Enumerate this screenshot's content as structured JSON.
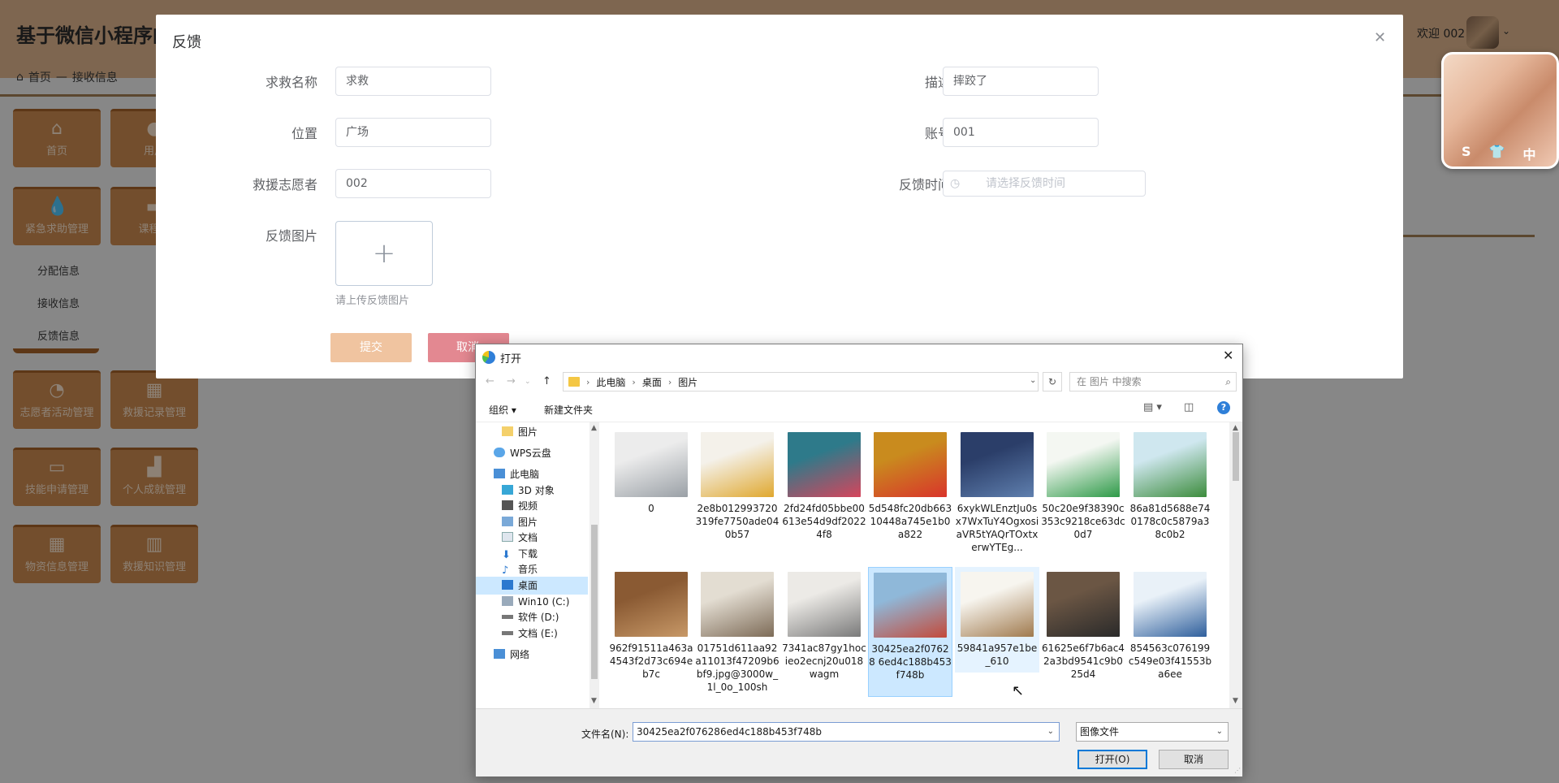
{
  "header": {
    "app_title": "基于微信小程序的",
    "welcome": "欢迎 002"
  },
  "breadcrumb": {
    "home": "首页",
    "separator": "—",
    "current": "接收信息"
  },
  "sidebar": {
    "tiles": [
      {
        "label": "首页",
        "icon": "home-icon"
      },
      {
        "label": "用户",
        "icon": "user-icon"
      },
      {
        "label": "紧急求助管理",
        "icon": "drop-icon"
      },
      {
        "label": "课程信",
        "icon": "doc-icon"
      },
      {
        "label": "志愿者活动管理",
        "icon": "pie-icon"
      },
      {
        "label": "救援记录管理",
        "icon": "grid-icon"
      },
      {
        "label": "技能申请管理",
        "icon": "briefcase-icon"
      },
      {
        "label": "个人成就管理",
        "icon": "chart-icon"
      },
      {
        "label": "物资信息管理",
        "icon": "grid-icon"
      },
      {
        "label": "救援知识管理",
        "icon": "book-icon"
      }
    ],
    "submenu": [
      "分配信息",
      "接收信息",
      "反馈信息"
    ]
  },
  "floating_photo": {
    "chips": [
      "S",
      "👕",
      "中"
    ]
  },
  "feedback_dialog": {
    "title": "反馈",
    "fields": {
      "rescue_name": {
        "label": "求救名称",
        "value": "求救"
      },
      "description": {
        "label": "描述",
        "value": "摔跤了"
      },
      "location": {
        "label": "位置",
        "value": "广场"
      },
      "account": {
        "label": "账号",
        "value": "001"
      },
      "volunteer": {
        "label": "救援志愿者",
        "value": "002"
      },
      "feedback_time": {
        "label": "反馈时间",
        "placeholder": "请选择反馈时间"
      },
      "feedback_image": {
        "label": "反馈图片",
        "tip": "请上传反馈图片"
      }
    },
    "submit": "提交",
    "cancel": "取消"
  },
  "file_dialog": {
    "title": "打开",
    "path": [
      "此电脑",
      "桌面",
      "图片"
    ],
    "search_placeholder": "在 图片 中搜索",
    "toolbar": {
      "organize": "组织 ▾",
      "new_folder": "新建文件夹"
    },
    "nav_pane": [
      {
        "label": "图片",
        "icon": "folder-icon",
        "indent": 2
      },
      {
        "label": "WPS云盘",
        "icon": "cloud-icon",
        "indent": 1
      },
      {
        "label": "此电脑",
        "icon": "pc-icon",
        "indent": 1
      },
      {
        "label": "3D 对象",
        "icon": "cube-icon",
        "indent": 2
      },
      {
        "label": "视频",
        "icon": "video-icon",
        "indent": 2
      },
      {
        "label": "图片",
        "icon": "picture-icon",
        "indent": 2
      },
      {
        "label": "文档",
        "icon": "document-icon",
        "indent": 2
      },
      {
        "label": "下载",
        "icon": "download-icon",
        "indent": 2
      },
      {
        "label": "音乐",
        "icon": "music-icon",
        "indent": 2
      },
      {
        "label": "桌面",
        "icon": "desktop-icon",
        "indent": 2,
        "selected": true
      },
      {
        "label": "Win10 (C:)",
        "icon": "drive-icon",
        "indent": 2
      },
      {
        "label": "软件 (D:)",
        "icon": "drive-icon",
        "indent": 2
      },
      {
        "label": "文档 (E:)",
        "icon": "drive-icon",
        "indent": 2
      },
      {
        "label": "网络",
        "icon": "network-icon",
        "indent": 1
      }
    ],
    "files": [
      {
        "name": "0",
        "colors": [
          "#ececec",
          "#9aa0a6"
        ]
      },
      {
        "name": "2e8b012993720319fe7750ade040b57",
        "colors": [
          "#f4f1ea",
          "#e0a82f"
        ]
      },
      {
        "name": "2fd24fd05bbe00613e54d9df20224f8",
        "colors": [
          "#2e7a8a",
          "#d6455c"
        ]
      },
      {
        "name": "5d548fc20db66310448a745e1b0a822",
        "colors": [
          "#c98b1e",
          "#d9342b"
        ]
      },
      {
        "name": "6xykWLEnztJu0sx7WxTuY4OgxosiaVR5tYAQrTOxtxerwYTEg...",
        "colors": [
          "#2b3e69",
          "#5f7fae"
        ]
      },
      {
        "name": "50c20e9f38390c353c9218ce63dc0d7",
        "colors": [
          "#f4f7f2",
          "#2e9a48"
        ]
      },
      {
        "name": "86a81d5688e740178c0c5879a38c0b2",
        "colors": [
          "#cfe7ef",
          "#3c8c3c"
        ]
      },
      {
        "name": "962f91511a463a4543f2d73c694eb7c",
        "colors": [
          "#8a5a33",
          "#c79867"
        ]
      },
      {
        "name": "01751d611aa92a11013f47209b6bf9.jpg@3000w_1l_0o_100sh",
        "colors": [
          "#e3ddd2",
          "#7d6b57"
        ]
      },
      {
        "name": "7341ac87gy1hocieo2ecnj20u018wagm",
        "colors": [
          "#eceae6",
          "#7a7a7a"
        ]
      },
      {
        "name": "30425ea2f07628 6ed4c188b453f748b",
        "colors": [
          "#8fb8d9",
          "#c34a3a"
        ],
        "selected": true
      },
      {
        "name": "59841a957e1be_610",
        "colors": [
          "#f7f5ef",
          "#a07a4e"
        ],
        "hover": true
      },
      {
        "name": "61625e6f7b6ac42a3bd9541c9b025d4",
        "colors": [
          "#6b5644",
          "#2a2a2a"
        ]
      },
      {
        "name": "854563c076199c549e03f41553ba6ee",
        "colors": [
          "#e9f1f8",
          "#2f5f9c"
        ]
      }
    ],
    "filename_label": "文件名(N):",
    "filename_value": "30425ea2f076286ed4c188b453f748b",
    "filetype": "图像文件",
    "open": "打开(O)",
    "cancel": "取消"
  }
}
